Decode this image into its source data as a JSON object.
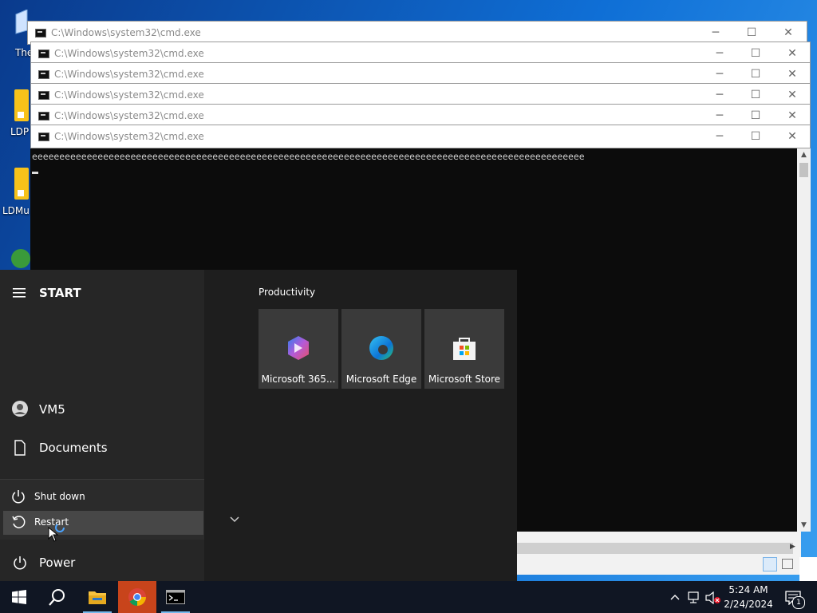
{
  "desktop": {
    "icon_labels": [
      "The",
      "LDP",
      "LDMu"
    ]
  },
  "cmd_windows": [
    {
      "title": "C:\\Windows\\system32\\cmd.exe"
    },
    {
      "title": "C:\\Windows\\system32\\cmd.exe"
    },
    {
      "title": "C:\\Windows\\system32\\cmd.exe"
    },
    {
      "title": "C:\\Windows\\system32\\cmd.exe"
    },
    {
      "title": "C:\\Windows\\system32\\cmd.exe"
    },
    {
      "title": "C:\\Windows\\system32\\cmd.exe"
    }
  ],
  "window_controls": {
    "minimize": "─",
    "maximize": "☐",
    "close": "✕"
  },
  "console": {
    "output": "eeeeeeeeeeeeeeeeeeeeeeeeeeeeeeeeeeeeeeeeeeeeeeeeeeeeeeeeeeeeeeeeeeeeeeeeeeeeeeeeeeeeeeeeeeeeeeeeeeeee"
  },
  "start_menu": {
    "header": "START",
    "user": "VM5",
    "documents": "Documents",
    "power_options": [
      "Shut down",
      "Restart"
    ],
    "power": "Power",
    "group_title": "Productivity",
    "tiles": [
      "Microsoft 365...",
      "Microsoft Edge",
      "Microsoft Store"
    ]
  },
  "taskbar": {
    "time": "5:24 AM",
    "date": "2/24/2024",
    "notification_count": "1"
  },
  "colors": {
    "taskbar": "#101623",
    "start_left": "#262626",
    "start_right": "#1e1e1e",
    "tile": "#3a3a3a",
    "accent": "#0078d7"
  }
}
